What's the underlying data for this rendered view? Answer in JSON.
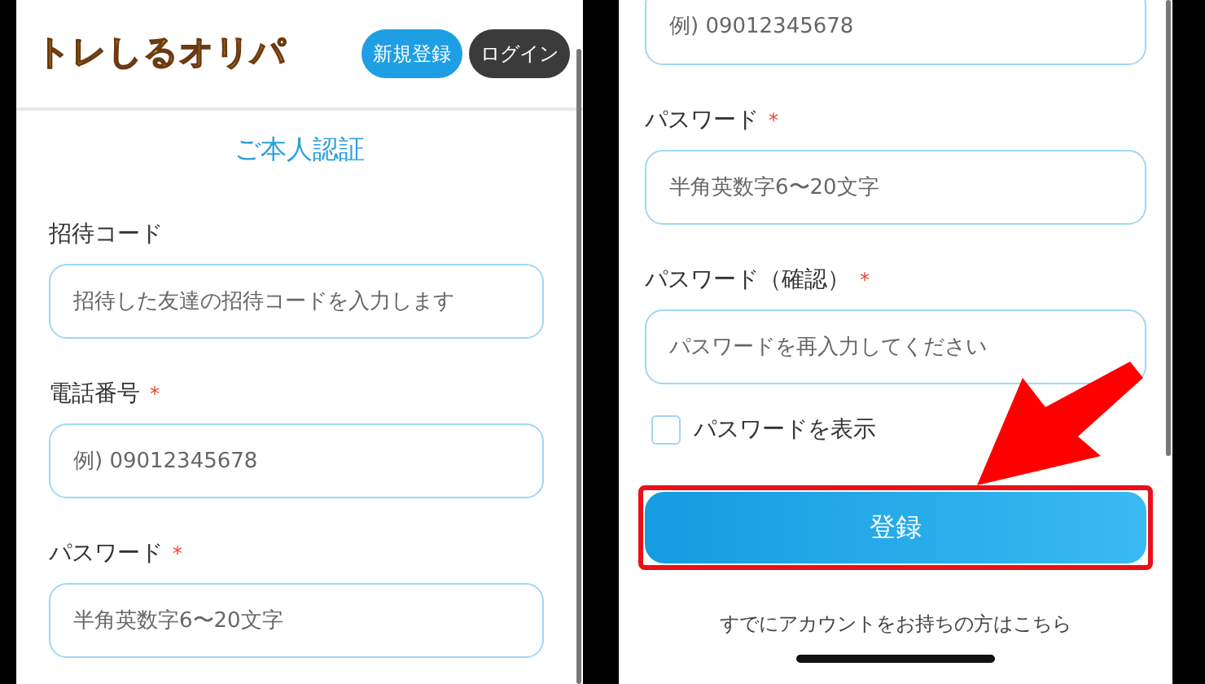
{
  "left_screen": {
    "logo": "トレしるオリパ",
    "header_buttons": [
      {
        "label": "新規登録",
        "kind": "primary"
      },
      {
        "label": "ログイン",
        "kind": "dark"
      }
    ],
    "title": "ご本人認証",
    "fields": [
      {
        "label": "招待コード",
        "placeholder": "招待した友達の招待コードを入力します"
      },
      {
        "label": "電話番号",
        "required_mark": "*",
        "placeholder": "例) 09012345678"
      },
      {
        "label": "パスワード",
        "required_mark": "*",
        "placeholder": "半角英数字6〜20文字"
      }
    ]
  },
  "right_screen": {
    "fields": [
      {
        "placeholder": "例) 09012345678"
      },
      {
        "label": "パスワード",
        "required_mark": "*",
        "placeholder": "半角英数字6〜20文字"
      },
      {
        "label": "パスワード（確認）",
        "required_mark": "*",
        "placeholder": "パスワードを再入力してください"
      }
    ],
    "show_password": {
      "label": "パスワードを表示",
      "checked": false
    },
    "submit_button": {
      "label": "登録",
      "highlighted": true
    },
    "login_link": "すでにアカウントをお持ちの方はこちら"
  }
}
